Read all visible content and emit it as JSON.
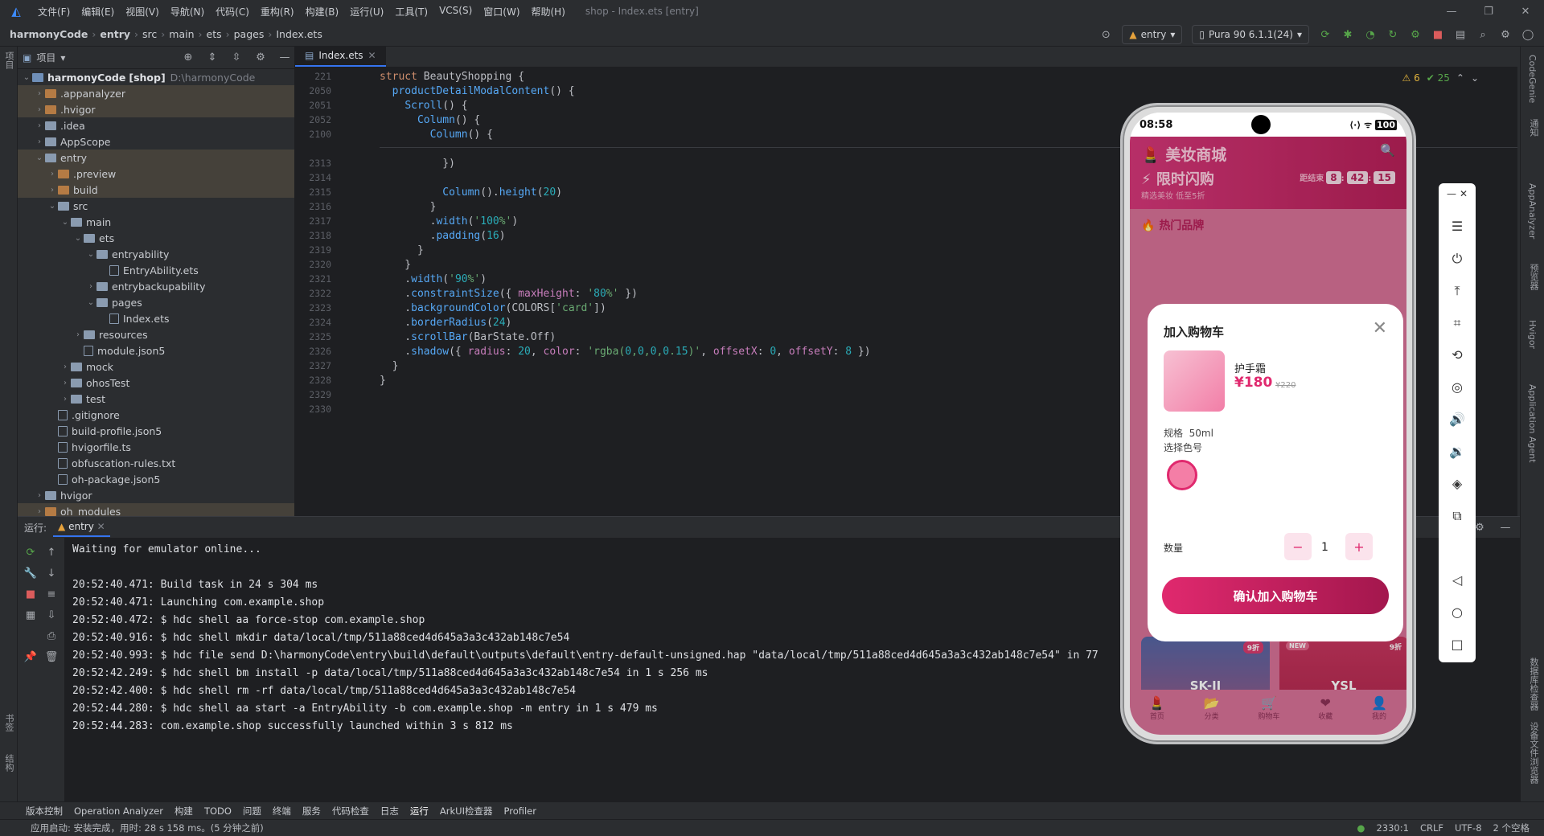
{
  "menu": {
    "items": [
      "文件(F)",
      "编辑(E)",
      "视图(V)",
      "导航(N)",
      "代码(C)",
      "重构(R)",
      "构建(B)",
      "运行(U)",
      "工具(T)",
      "VCS(S)",
      "窗口(W)",
      "帮助(H)"
    ],
    "window_title": "shop - Index.ets [entry]"
  },
  "breadcrumb": {
    "items": [
      "harmonyCode",
      "entry",
      "src",
      "main",
      "ets",
      "pages",
      "Index.ets"
    ]
  },
  "toolbar": {
    "config": "entry",
    "device": "Pura 90 6.1.1(24)"
  },
  "project_panel": {
    "title": "项目",
    "tree": [
      {
        "label": "harmonyCode",
        "extra": "[shop]",
        "path": "D:\\harmonyCode",
        "depth": 0,
        "open": true,
        "type": "module"
      },
      {
        "label": ".appanalyzer",
        "depth": 1,
        "type": "folder-o",
        "hl": true
      },
      {
        "label": ".hvigor",
        "depth": 1,
        "type": "folder-o",
        "hl": true
      },
      {
        "label": ".idea",
        "depth": 1,
        "type": "folder"
      },
      {
        "label": "AppScope",
        "depth": 1,
        "type": "folder"
      },
      {
        "label": "entry",
        "depth": 1,
        "open": true,
        "type": "folder",
        "hl": true
      },
      {
        "label": ".preview",
        "depth": 2,
        "type": "folder-o",
        "hl": true
      },
      {
        "label": "build",
        "depth": 2,
        "type": "folder-o",
        "hl": true
      },
      {
        "label": "src",
        "depth": 2,
        "open": true,
        "type": "folder"
      },
      {
        "label": "main",
        "depth": 3,
        "open": true,
        "type": "folder"
      },
      {
        "label": "ets",
        "depth": 4,
        "open": true,
        "type": "folder"
      },
      {
        "label": "entryability",
        "depth": 5,
        "open": true,
        "type": "folder"
      },
      {
        "label": "EntryAbility.ets",
        "depth": 6,
        "type": "file"
      },
      {
        "label": "entrybackupability",
        "depth": 5,
        "type": "folder"
      },
      {
        "label": "pages",
        "depth": 5,
        "open": true,
        "type": "folder"
      },
      {
        "label": "Index.ets",
        "depth": 6,
        "type": "file"
      },
      {
        "label": "resources",
        "depth": 4,
        "type": "folder"
      },
      {
        "label": "module.json5",
        "depth": 4,
        "type": "file"
      },
      {
        "label": "mock",
        "depth": 3,
        "type": "folder"
      },
      {
        "label": "ohosTest",
        "depth": 3,
        "type": "folder"
      },
      {
        "label": "test",
        "depth": 3,
        "type": "folder"
      },
      {
        "label": ".gitignore",
        "depth": 2,
        "type": "file"
      },
      {
        "label": "build-profile.json5",
        "depth": 2,
        "type": "file"
      },
      {
        "label": "hvigorfile.ts",
        "depth": 2,
        "type": "file"
      },
      {
        "label": "obfuscation-rules.txt",
        "depth": 2,
        "type": "file"
      },
      {
        "label": "oh-package.json5",
        "depth": 2,
        "type": "file"
      },
      {
        "label": "hvigor",
        "depth": 1,
        "type": "folder"
      },
      {
        "label": "oh_modules",
        "depth": 1,
        "type": "folder-o",
        "hl": true
      }
    ]
  },
  "editor": {
    "tab": "Index.ets",
    "inspections": {
      "warnings": "6",
      "ok": "25"
    },
    "sticky": [
      {
        "ln": "221",
        "code": "struct BeautyShopping {"
      },
      {
        "ln": "2050",
        "code": "  productDetailModalContent() {"
      },
      {
        "ln": "2051",
        "code": "    Scroll() {"
      },
      {
        "ln": "2052",
        "code": "      Column() {"
      },
      {
        "ln": "2100",
        "code": "        Column() {"
      }
    ],
    "lines": [
      {
        "ln": "2313",
        "code": "          })"
      },
      {
        "ln": "2314",
        "code": ""
      },
      {
        "ln": "2315",
        "code": "          Column().height(20)"
      },
      {
        "ln": "2316",
        "code": "        }"
      },
      {
        "ln": "2317",
        "code": "        .width('100%')"
      },
      {
        "ln": "2318",
        "code": "        .padding(16)"
      },
      {
        "ln": "2319",
        "code": "      }"
      },
      {
        "ln": "2320",
        "code": "    }"
      },
      {
        "ln": "2321",
        "code": "    .width('90%')"
      },
      {
        "ln": "2322",
        "code": "    .constraintSize({ maxHeight: '80%' })"
      },
      {
        "ln": "2323",
        "code": "    .backgroundColor(COLORS['card'])"
      },
      {
        "ln": "2324",
        "code": "    .borderRadius(24)"
      },
      {
        "ln": "2325",
        "code": "    .scrollBar(BarState.Off)"
      },
      {
        "ln": "2326",
        "code": "    .shadow({ radius: 20, color: 'rgba(0,0,0,0.15)', offsetX: 0, offsetY: 8 })"
      },
      {
        "ln": "2327",
        "code": "  }"
      },
      {
        "ln": "2328",
        "code": "}"
      },
      {
        "ln": "2329",
        "code": ""
      },
      {
        "ln": "2330",
        "code": ""
      }
    ]
  },
  "run_panel": {
    "label": "运行:",
    "tab": "entry",
    "lines": [
      "Waiting for emulator online...",
      "",
      "20:52:40.471: Build task in 24 s 304 ms",
      "20:52:40.471: Launching com.example.shop",
      "20:52:40.472: $ hdc shell aa force-stop com.example.shop",
      "20:52:40.916: $ hdc shell mkdir data/local/tmp/511a88ced4d645a3a3c432ab148c7e54",
      "20:52:40.993: $ hdc file send D:\\harmonyCode\\entry\\build\\default\\outputs\\default\\entry-default-unsigned.hap \"data/local/tmp/511a88ced4d645a3a3c432ab148c7e54\" in 77",
      "20:52:42.249: $ hdc shell bm install -p data/local/tmp/511a88ced4d645a3a3c432ab148c7e54 in 1 s 256 ms",
      "20:52:42.400: $ hdc shell rm -rf data/local/tmp/511a88ced4d645a3a3c432ab148c7e54",
      "20:52:44.280: $ hdc shell aa start -a EntryAbility -b com.example.shop -m entry in 1 s 479 ms",
      "20:52:44.283: com.example.shop successfully launched within 3 s 812 ms"
    ]
  },
  "tool_windows": [
    "版本控制",
    "Operation Analyzer",
    "构建",
    "TODO",
    "问题",
    "终端",
    "服务",
    "代码检查",
    "日志",
    "运行",
    "ArkUI检查器",
    "Profiler"
  ],
  "status": {
    "left": "应用启动: 安装完成，用时: 28 s 158 ms。(5 分钟之前)",
    "pos": "2330:1",
    "eol": "CRLF",
    "enc": "UTF-8",
    "indent": "2 个空格"
  },
  "left_strip": {
    "top": "项目",
    "bottom1": "书签",
    "bottom2": "结构"
  },
  "right_strip": [
    "CodeGenie",
    "通知",
    "AppAnalyzer",
    "预览器",
    "Hvigor",
    "Application Agent",
    "数据库检查器",
    "设备文件浏览器"
  ],
  "phone": {
    "time": "08:58",
    "battery": "100",
    "app_title": "美妆商城",
    "flash_title": "限时闪购",
    "flash_sub": "精选美妆 低至5折",
    "countdown_label": "距结束",
    "countdown": [
      "8",
      "42",
      "15"
    ],
    "hot_brands": "热门品牌",
    "modal": {
      "title": "加入购物车",
      "product": "护手霜",
      "price": "¥180",
      "old_price": "¥220",
      "spec_label": "规格",
      "spec_value": "50ml",
      "color_label": "选择色号",
      "qty_label": "数量",
      "qty": "1",
      "minus": "−",
      "plus": "+",
      "confirm": "确认加入购物车"
    },
    "cards": [
      {
        "name": "SK-II",
        "badge": "9折",
        "tag": ""
      },
      {
        "name": "YSL",
        "badge": "9折",
        "tag": "NEW"
      }
    ],
    "tabs": [
      "首页",
      "分类",
      "购物车",
      "收藏",
      "我的"
    ]
  }
}
